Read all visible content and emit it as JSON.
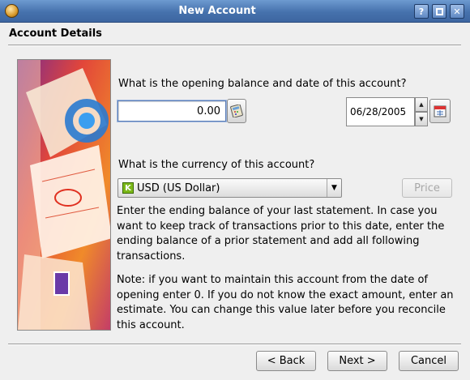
{
  "window": {
    "title": "New Account",
    "help_label": "?",
    "maximize_label": "□",
    "close_label": "✕"
  },
  "header": {
    "title": "Account Details"
  },
  "opening": {
    "question": "What is the opening balance and date of this account?",
    "amount_value": "0.00",
    "date_value": "06/28/2005"
  },
  "currency": {
    "question": "What is the currency of this account?",
    "icon_letter": "K",
    "selected": "USD (US Dollar)",
    "price_label": "Price"
  },
  "help_text": {
    "paragraph1": "Enter the ending balance of your last statement. In case you want to keep track of transactions prior to this date, enter the ending balance of a prior statement and add all following transactions.",
    "paragraph2": "Note: if you want to maintain this account from the date of opening enter 0. If you do not know the exact amount, enter an estimate. You can change this value later before you reconcile this account."
  },
  "buttons": {
    "back": "< Back",
    "next": "Next >",
    "cancel": "Cancel"
  },
  "icons": {
    "app": "kmymoney-app-icon",
    "calculator": "calculator-icon",
    "calendar": "calendar-icon",
    "currency_flag": "currency-k-icon"
  }
}
